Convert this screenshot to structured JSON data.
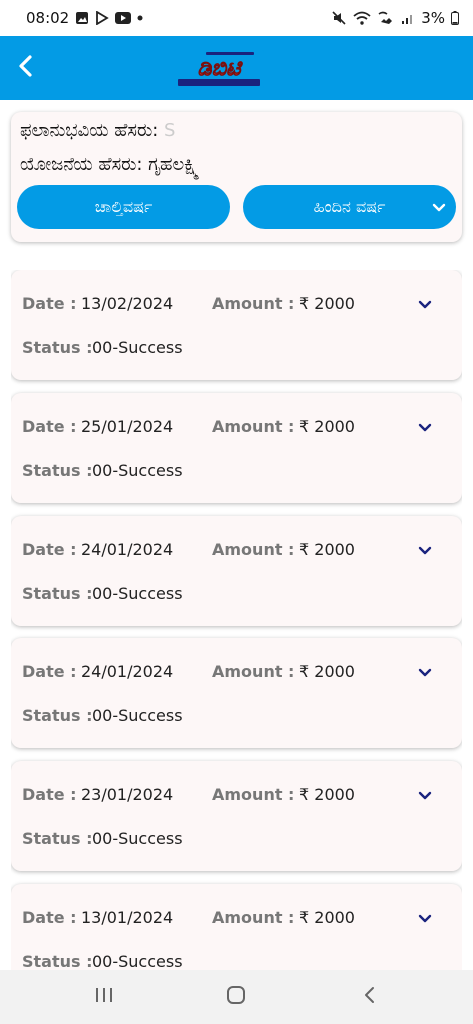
{
  "status_bar": {
    "time": "08:02",
    "notification_icons": [
      "gallery-icon",
      "play-store-icon",
      "youtube-icon",
      "dot-icon"
    ],
    "system_icons": [
      "mute-icon",
      "wifi-icon",
      "wifi-call-icon",
      "signal-icon"
    ],
    "battery": "3%"
  },
  "app_bar": {
    "back_icon": "chevron-left-icon",
    "logo_text": "ಡಿಬಿಟಿ",
    "background": "#039be5"
  },
  "beneficiary": {
    "name_label": "ಫಲಾನುಭವಿಯ ಹೆಸರು: ",
    "name_value": "S",
    "scheme_label": "ಯೋಜನೆಯ ಹೆಸರು: ",
    "scheme_value": "ಗೃಹಲಕ್ಷ್ಮಿ",
    "current_year_button": "ಚಾಲ್ತಿವರ್ಷ",
    "previous_year_button": "ಹಿಂದಿನ ವರ್ಷ"
  },
  "labels": {
    "date": "Date :",
    "amount": "Amount :",
    "status": "Status :"
  },
  "transactions": [
    {
      "date": "13/02/2024",
      "amount": "₹ 2000",
      "status": "00-Success"
    },
    {
      "date": "25/01/2024",
      "amount": "₹ 2000",
      "status": "00-Success"
    },
    {
      "date": "24/01/2024",
      "amount": "₹ 2000",
      "status": "00-Success"
    },
    {
      "date": "24/01/2024",
      "amount": "₹ 2000",
      "status": "00-Success"
    },
    {
      "date": "23/01/2024",
      "amount": "₹ 2000",
      "status": "00-Success"
    },
    {
      "date": "13/01/2024",
      "amount": "₹ 2000",
      "status": "00-Success"
    }
  ],
  "nav_bar": {
    "buttons": [
      "recents-icon",
      "home-icon",
      "back-icon"
    ]
  }
}
